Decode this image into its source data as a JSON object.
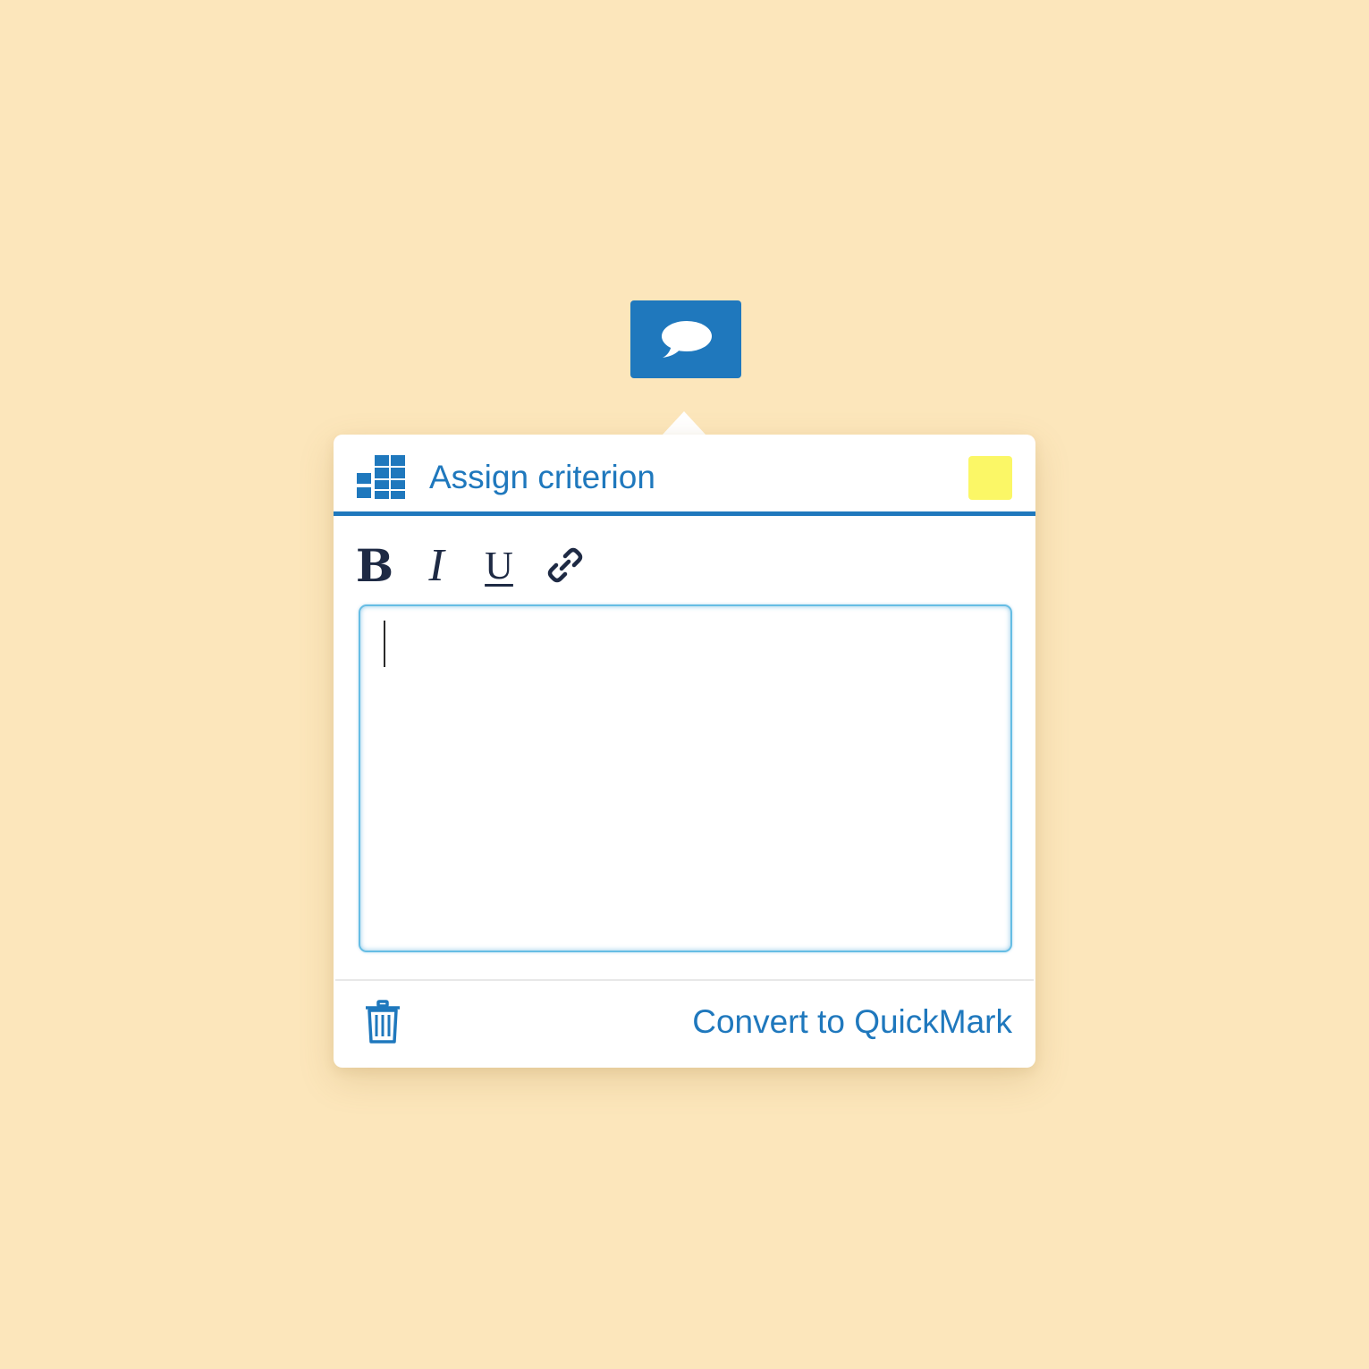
{
  "comment_marker": {
    "icon": "speech-bubble-icon",
    "color": "#1f78bd"
  },
  "popover": {
    "header": {
      "rubric_icon": "rubric-grid-icon",
      "assign_criterion_label": "Assign criterion",
      "highlight_color": "#fbf766"
    },
    "toolbar": {
      "bold_label": "B",
      "italic_label": "I",
      "underline_label": "U",
      "link_icon": "link-icon"
    },
    "editor": {
      "value": "",
      "placeholder": ""
    },
    "footer": {
      "delete_icon": "trash-icon",
      "convert_label": "Convert to QuickMark"
    }
  },
  "colors": {
    "background": "#fce6bb",
    "accent": "#1f78bd",
    "editor_focus": "#66bde4",
    "text_dark": "#1e2a44"
  }
}
